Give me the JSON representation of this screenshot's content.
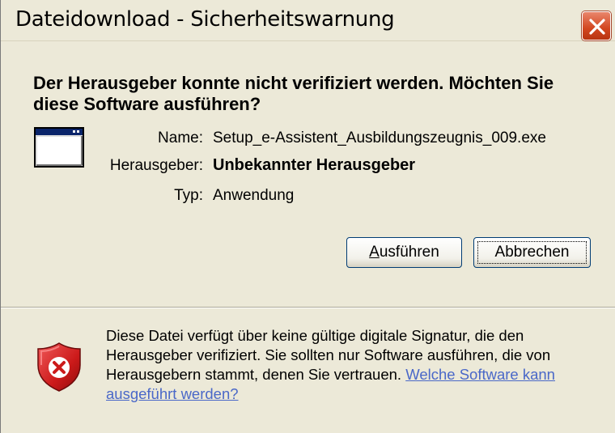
{
  "window": {
    "title": "Dateidownload - Sicherheitswarnung",
    "close_icon": "close-icon"
  },
  "question": "Der Herausgeber konnte nicht verifiziert werden. Möchten Sie diese Software ausführen?",
  "file_info": {
    "name_label": "Name:",
    "name_value": "Setup_e-Assistent_Ausbildungszeugnis_009.exe",
    "publisher_label": "Herausgeber:",
    "publisher_value": "Unbekannter Herausgeber",
    "type_label": "Typ:",
    "type_value": "Anwendung"
  },
  "buttons": {
    "run_prefix": "",
    "run_accel": "A",
    "run_rest": "usführen",
    "cancel": "Abbrechen"
  },
  "warning": {
    "text": "Diese Datei verfügt über keine gültige digitale Signatur, die den Herausgeber verifiziert. Sie sollten nur Software ausführen, die von Herausgebern stammt, denen Sie vertrauen.",
    "link": "Welche Software kann ausgeführt werden?"
  },
  "colors": {
    "dialog_bg": "#ece9d8",
    "link": "#4a68c8",
    "close_button": "#d2461f",
    "shield_red": "#cc1a1a"
  }
}
